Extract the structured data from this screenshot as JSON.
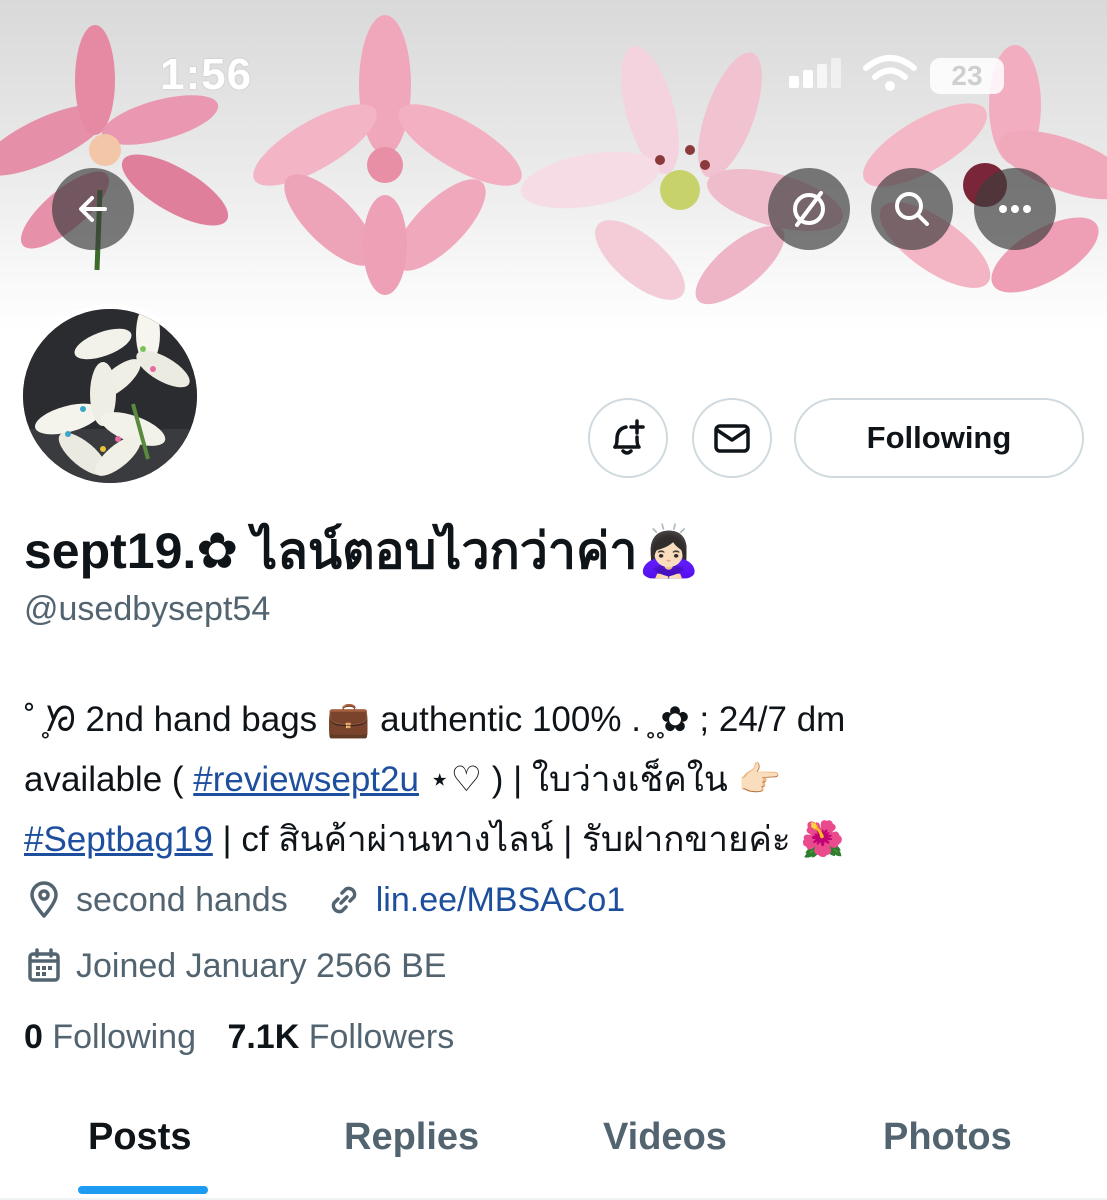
{
  "status_bar": {
    "time": "1:56",
    "battery": "23"
  },
  "profile": {
    "display_name": "sept19.✿ ไลน์ตอบไวกว่าค่า🙇🏻‍♀️",
    "handle": "@usedbysept54",
    "following_button": "Following",
    "bio": {
      "line1": "˚ ̥ᘞ 2nd hand bags 💼 authentic 100% . ̥ ̥✿ ; 24/7 dm",
      "line2_pre": "available ( ",
      "line2_link": "#reviewsept2u",
      "line2_post": " ⋆♡ ) | ใบว่างเช็คใน 👉🏻",
      "line3_link": "#Septbag19",
      "line3_post": " | cf สินค้าผ่านทางไลน์ | รับฝากขายค่ะ 🌺"
    },
    "location": "second hands",
    "website": "lin.ee/MBSACo1",
    "joined": "Joined January 2566 BE",
    "following_count": "0",
    "following_label": "Following",
    "followers_count": "7.1K",
    "followers_label": "Followers"
  },
  "tabs": [
    "Posts",
    "Replies",
    "Videos",
    "Photos"
  ],
  "active_tab": "Posts",
  "colors": {
    "link": "#1d4f9e",
    "tab_indicator": "#1d9bf0",
    "secondary_text": "#536471"
  }
}
